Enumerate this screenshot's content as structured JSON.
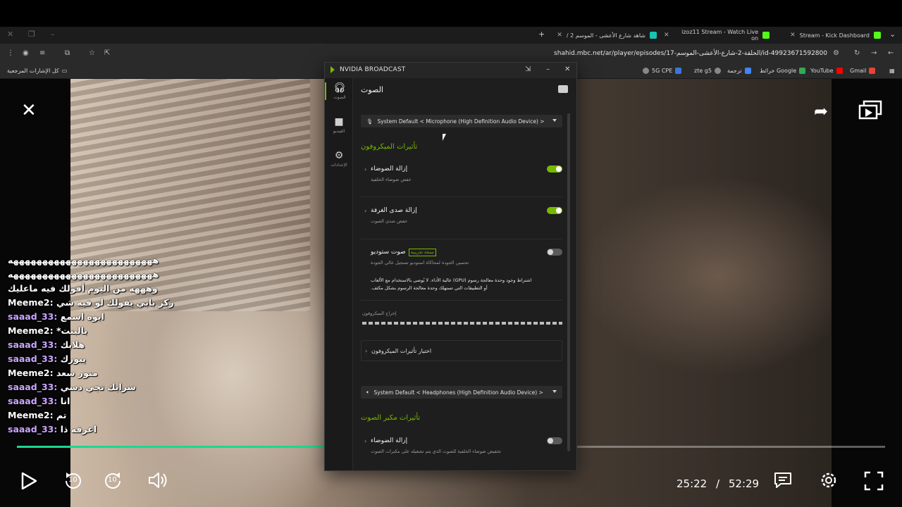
{
  "browser": {
    "tabs": [
      {
        "title": "Stream - Kick Dashboard"
      },
      {
        "title": "izoz11 Stream - Watch Live on"
      },
      {
        "title": "شاهد شارع الأعشى - الموسم 2 /"
      }
    ],
    "url": "shahid.mbc.net/ar/player/episodes/17-الحلقة-2-شارع-الأعشى-الموسم/id-49923671592800",
    "bookmarks": [
      {
        "label": "Gmail"
      },
      {
        "label": "YouTube"
      },
      {
        "label": "خرائط Google"
      },
      {
        "label": "ترجمة"
      },
      {
        "label": "zte g5"
      },
      {
        "label": "5G CPE"
      }
    ],
    "bookmarks_folder": "كل الإشارات المرجعية"
  },
  "chat": [
    {
      "user": "",
      "text": "هههههههههههههههههههههههههه",
      "muser": false
    },
    {
      "user": "",
      "text": "هههههههههههههههههههههههههه",
      "muser": false
    },
    {
      "user": "",
      "text": "وهههه من اليوم أقولك فيه ماعليك",
      "muser": false
    },
    {
      "user": "Meeme2:",
      "text": "ركز بابي يقولك لو فيه شي",
      "muser": true
    },
    {
      "user": "saaad_33:",
      "text": "ابوه اسمع",
      "muser": false
    },
    {
      "user": "Meeme2:",
      "text": "*بالبنت",
      "muser": true
    },
    {
      "user": "saaad_33:",
      "text": "هلابك",
      "muser": false
    },
    {
      "user": "saaad_33:",
      "text": "يبورك",
      "muser": false
    },
    {
      "user": "Meeme2:",
      "text": "منور سعد",
      "muser": true
    },
    {
      "user": "saaad_33:",
      "text": "سرابك تجي دسي",
      "muser": false
    },
    {
      "user": "saaad_33:",
      "text": "انا",
      "muser": false
    },
    {
      "user": "Meeme2:",
      "text": "تم",
      "muser": true
    },
    {
      "user": "saaad_33:",
      "text": "اعرفه ذا",
      "muser": false
    }
  ],
  "player": {
    "current_time": "25:22",
    "separator": "/",
    "duration": "52:29",
    "progress": 0.483,
    "skip_seconds": "10"
  },
  "nvidia": {
    "app_title": "NVIDIA BROADCAST",
    "sidebar": [
      {
        "label": "الصوت",
        "icon": "headset-icon"
      },
      {
        "label": "الفيديو",
        "icon": "camera-icon"
      },
      {
        "label": "الإعدادات",
        "icon": "gear-icon"
      }
    ],
    "page_title": "الصوت",
    "mic_device": "System Default < Microphone (High Definition Audio Device) >",
    "mic_section": "تأثيرات الميكروفون",
    "effects": [
      {
        "name": "إزالة الضوضاء",
        "desc": "خفض ضوضاء الخلفية",
        "on": true
      },
      {
        "name": "إزالة صدى الغرفة",
        "desc": "خفض صدى الصوت",
        "on": true
      },
      {
        "name": "صوت ستوديو",
        "desc": "تحسين الجودة لمحاكاة استوديو تسجيل عالي الجودة",
        "on": false,
        "badge": "نسخة تجريبية"
      }
    ],
    "studio_warning_1": "عالية الأداء. لا يُوصى بالاستخدام مع الألعاب (GPU) اشتراط وجود وحدة معالجة رسوم",
    "studio_warning_2": ".أو التطبيقات التي تستهلك وحدة معالجة الرسوم بشكل مكثف",
    "meter_label": "إخراج الميكروفون",
    "add_effect": "اختيار تأثيرات الميكروفون",
    "speaker_device": "System Default < Headphones (High Definition Audio Device) >",
    "speaker_section": "تأثيرات مكبر الصوت",
    "speaker_effect": {
      "name": "إزالة الضوضاء",
      "desc": "تخفيض ضوضاء الخلفية للصوت الذي يتم تشغيله على مكبرات الصوت",
      "on": false
    }
  },
  "colors": {
    "nvidia_green": "#76b900",
    "progress_green": "#1ed68f",
    "chat_user": "#c9a7ff"
  }
}
